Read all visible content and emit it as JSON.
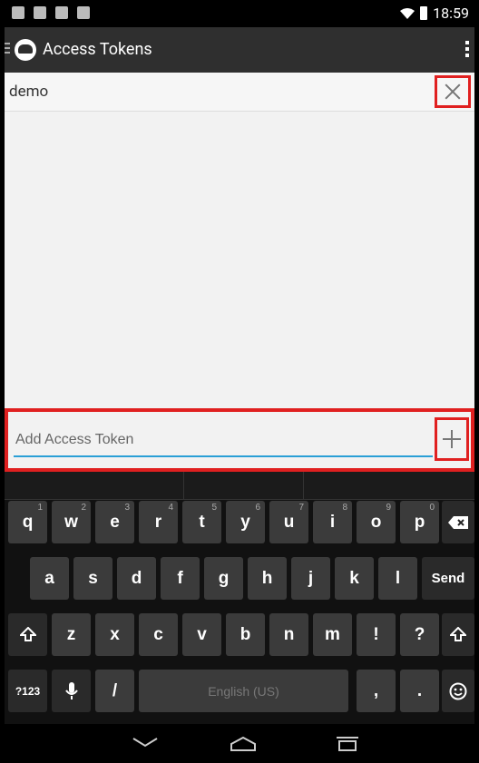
{
  "status_bar": {
    "time": "18:59"
  },
  "app_bar": {
    "title": "Access Tokens"
  },
  "tokens": [
    {
      "name": "demo"
    }
  ],
  "add_token": {
    "placeholder": "Add Access Token"
  },
  "keyboard": {
    "row1": [
      {
        "label": "q",
        "hint": "1"
      },
      {
        "label": "w",
        "hint": "2"
      },
      {
        "label": "e",
        "hint": "3"
      },
      {
        "label": "r",
        "hint": "4"
      },
      {
        "label": "t",
        "hint": "5"
      },
      {
        "label": "y",
        "hint": "6"
      },
      {
        "label": "u",
        "hint": "7"
      },
      {
        "label": "i",
        "hint": "8"
      },
      {
        "label": "o",
        "hint": "9"
      },
      {
        "label": "p",
        "hint": "0"
      }
    ],
    "row2": [
      "a",
      "s",
      "d",
      "f",
      "g",
      "h",
      "j",
      "k",
      "l"
    ],
    "send_label": "Send",
    "row3": [
      "z",
      "x",
      "c",
      "v",
      "b",
      "n",
      "m",
      "!",
      "?"
    ],
    "symbols_label": "?123",
    "slash_label": "/",
    "space_label": "English (US)",
    "comma_label": ",",
    "period_label": "."
  }
}
